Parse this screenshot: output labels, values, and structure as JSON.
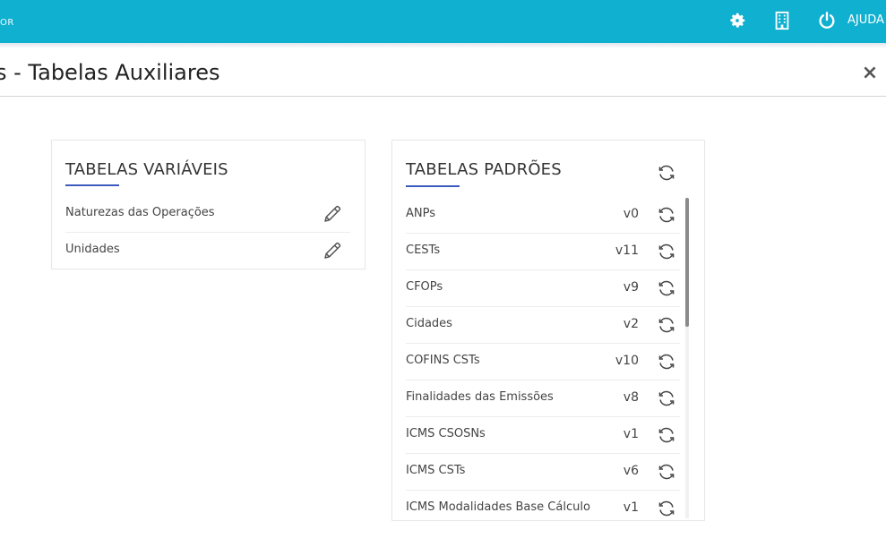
{
  "topbar": {
    "left_label": "OR",
    "settings_icon": "gear-icon",
    "building_icon": "building-icon",
    "power_icon": "power-icon",
    "help_label": "AJUDA",
    "bg_color": "#10b0d0"
  },
  "header": {
    "title": "s - Tabelas Auxiliares",
    "close_label": "×"
  },
  "variable_tables": {
    "title": "TABELAS VARIÁVEIS",
    "accent_color": "#3b5bbf",
    "items": [
      {
        "label": "Naturezas das Operações",
        "icon": "pencil-icon"
      },
      {
        "label": "Unidades",
        "icon": "pencil-icon"
      }
    ]
  },
  "standard_tables": {
    "title": "TABELAS PADRÕES",
    "header_icon": "refresh-icon",
    "items": [
      {
        "label": "ANPs",
        "version": "v0"
      },
      {
        "label": "CESTs",
        "version": "v11"
      },
      {
        "label": "CFOPs",
        "version": "v9"
      },
      {
        "label": "Cidades",
        "version": "v2"
      },
      {
        "label": "COFINS CSTs",
        "version": "v10"
      },
      {
        "label": "Finalidades das Emissões",
        "version": "v8"
      },
      {
        "label": "ICMS CSOSNs",
        "version": "v1"
      },
      {
        "label": "ICMS CSTs",
        "version": "v6"
      },
      {
        "label": "ICMS Modalidades Base Cálculo",
        "version": "v1"
      }
    ]
  }
}
